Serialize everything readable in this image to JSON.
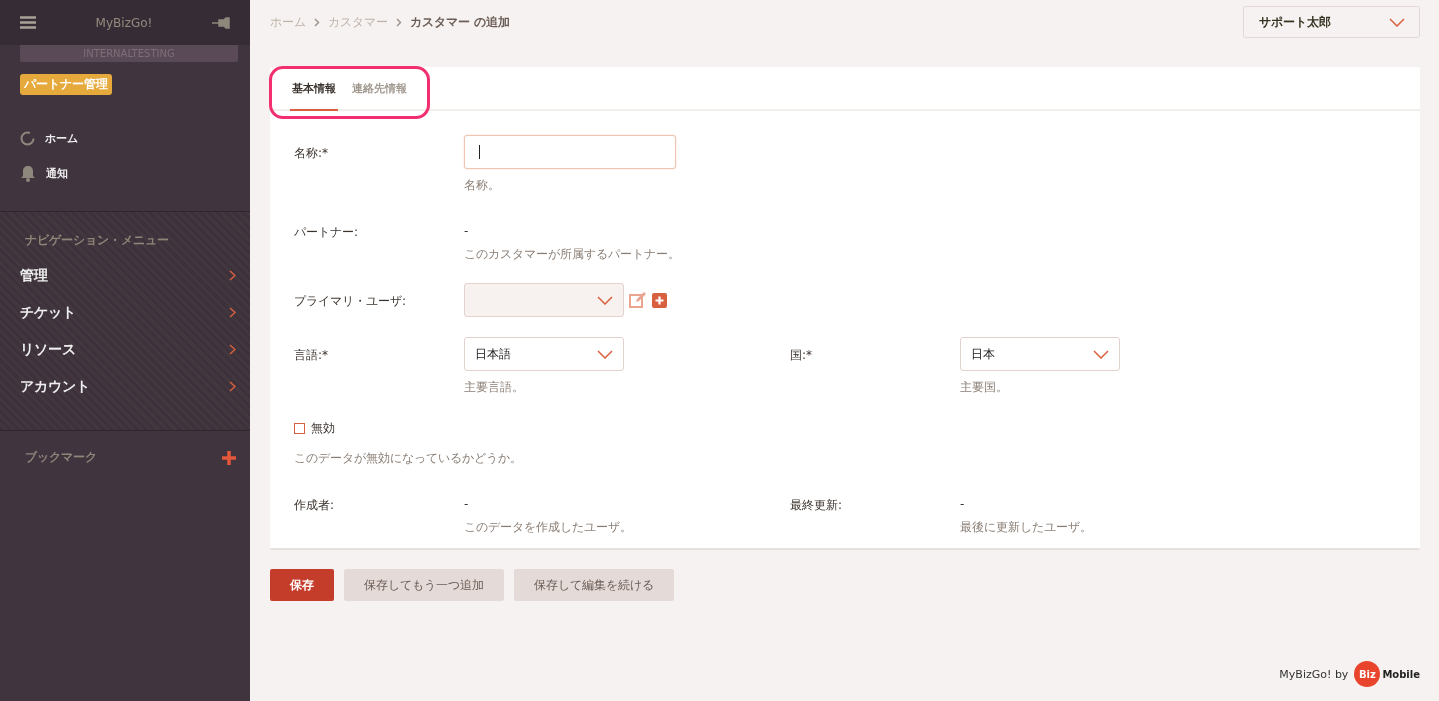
{
  "sidebar": {
    "title": "MyBizGo!",
    "environment": "INTERNALTESTING",
    "badge": "パートナー管理",
    "quick_links": [
      {
        "label": "ホーム"
      },
      {
        "label": "通知"
      }
    ],
    "nav_heading": "ナビゲーション・メニュー",
    "nav_items": [
      {
        "label": "管理"
      },
      {
        "label": "チケット"
      },
      {
        "label": "リソース"
      },
      {
        "label": "アカウント"
      }
    ],
    "bookmarks_label": "ブックマーク"
  },
  "breadcrumb": {
    "links": [
      "ホーム",
      "カスタマー"
    ],
    "current": "カスタマー の追加"
  },
  "user_menu": "サポート太郎",
  "tabs": [
    {
      "label": "基本情報",
      "selected": true
    },
    {
      "label": "連絡先情報",
      "selected": false
    }
  ],
  "form": {
    "rows": [
      [
        {
          "kind": "text",
          "label": "名称:*",
          "focused": true,
          "help": "名称。"
        }
      ],
      [
        {
          "kind": "static",
          "label": "パートナー:",
          "value": "-",
          "help": "このカスタマーが所属するパートナー。"
        }
      ],
      [
        {
          "kind": "select_actions",
          "label": "プライマリ・ユーザ:",
          "disabled": true
        }
      ],
      [
        {
          "kind": "select",
          "label": "言語:*",
          "value": "日本語",
          "help": "主要言語。"
        },
        {
          "kind": "select",
          "label": "国:*",
          "value": "日本",
          "help": "主要国。"
        }
      ],
      [
        {
          "kind": "checkbox",
          "label": "無効",
          "checked": false,
          "help": "このデータが無効になっているかどうか。"
        }
      ],
      [
        {
          "kind": "static",
          "label": "作成者:",
          "value": "-",
          "help": "このデータを作成したユーザ。"
        },
        {
          "kind": "static",
          "label": "最終更新:",
          "value": "-",
          "help": "最後に更新したユーザ。"
        }
      ]
    ]
  },
  "buttons": [
    {
      "label": "保存",
      "kind": "primary"
    },
    {
      "label": "保存してもう一つ追加",
      "kind": "secondary"
    },
    {
      "label": "保存して編集を続ける",
      "kind": "secondary"
    }
  ],
  "footer": {
    "text": "MyBizGo! by",
    "logo_left": "Biz",
    "logo_right": "Mobile"
  }
}
